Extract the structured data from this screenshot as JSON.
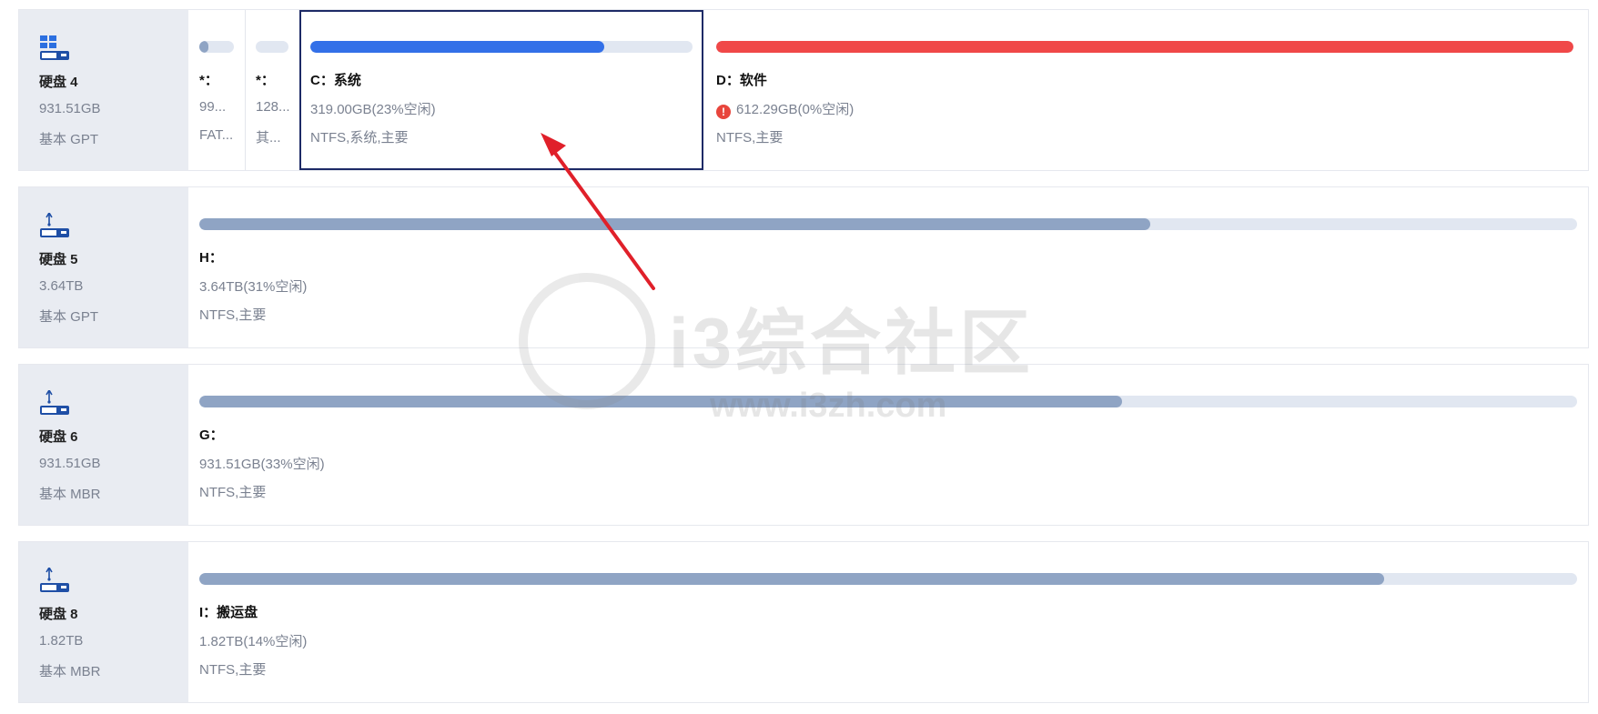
{
  "disks": [
    {
      "icon": "ssd-windows-icon",
      "name": "硬盘 4",
      "size": "931.51GB",
      "type": "基本 GPT",
      "partitions": [
        {
          "label": "*：",
          "size": "99...",
          "fs": "FAT...",
          "used_fraction": 0.25,
          "color": "#8fa4c4"
        },
        {
          "label": "*：",
          "size": "128...",
          "fs": "其...",
          "used_fraction": 0.0,
          "color": "#8fa4c4"
        },
        {
          "label": "C：系统",
          "size": "319.00GB(23%空闲)",
          "fs": "NTFS,系统,主要",
          "used_fraction": 0.77,
          "color": "#3370e8",
          "selected": true
        },
        {
          "label": "D：软件",
          "size": "612.29GB(0%空闲)",
          "fs": "NTFS,主要",
          "used_fraction": 1.0,
          "color": "#f04848",
          "warning": true
        }
      ]
    },
    {
      "icon": "hdd-usb-icon",
      "name": "硬盘 5",
      "size": "3.64TB",
      "type": "基本 GPT",
      "partitions": [
        {
          "label": "H：",
          "size": "3.64TB(31%空闲)",
          "fs": "NTFS,主要",
          "used_fraction": 0.69,
          "color": "#8fa4c4"
        }
      ]
    },
    {
      "icon": "hdd-usb-icon",
      "name": "硬盘 6",
      "size": "931.51GB",
      "type": "基本 MBR",
      "partitions": [
        {
          "label": "G：",
          "size": "931.51GB(33%空闲)",
          "fs": "NTFS,主要",
          "used_fraction": 0.67,
          "color": "#8fa4c4"
        }
      ]
    },
    {
      "icon": "hdd-usb-icon",
      "name": "硬盘 8",
      "size": "1.82TB",
      "type": "基本 MBR",
      "partitions": [
        {
          "label": "I：搬运盘",
          "size": "1.82TB(14%空闲)",
          "fs": "NTFS,主要",
          "used_fraction": 0.86,
          "color": "#8fa4c4"
        }
      ]
    }
  ],
  "watermark": {
    "text": "i3综合社区",
    "url": "www.i3zh.com"
  }
}
